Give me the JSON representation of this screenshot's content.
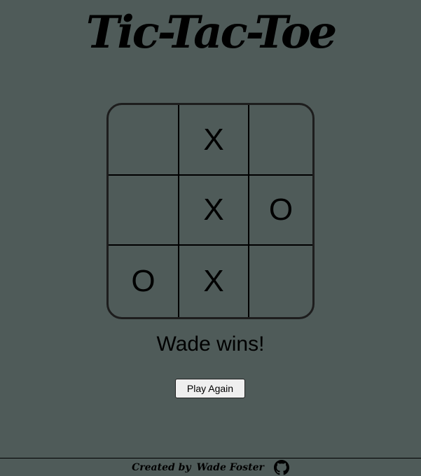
{
  "title": "Tic-Tac-Toe",
  "board": {
    "cells": [
      "",
      "X",
      "",
      "",
      "X",
      "O",
      "O",
      "X",
      ""
    ]
  },
  "status": "Wade wins!",
  "play_again_label": "Play Again",
  "footer": {
    "created_by_label": "Created by",
    "author": "Wade Foster",
    "icon": "github-icon"
  },
  "colors": {
    "background": "#4f5b59",
    "board_border": "#1d1d1d",
    "button_bg": "#efefef"
  }
}
